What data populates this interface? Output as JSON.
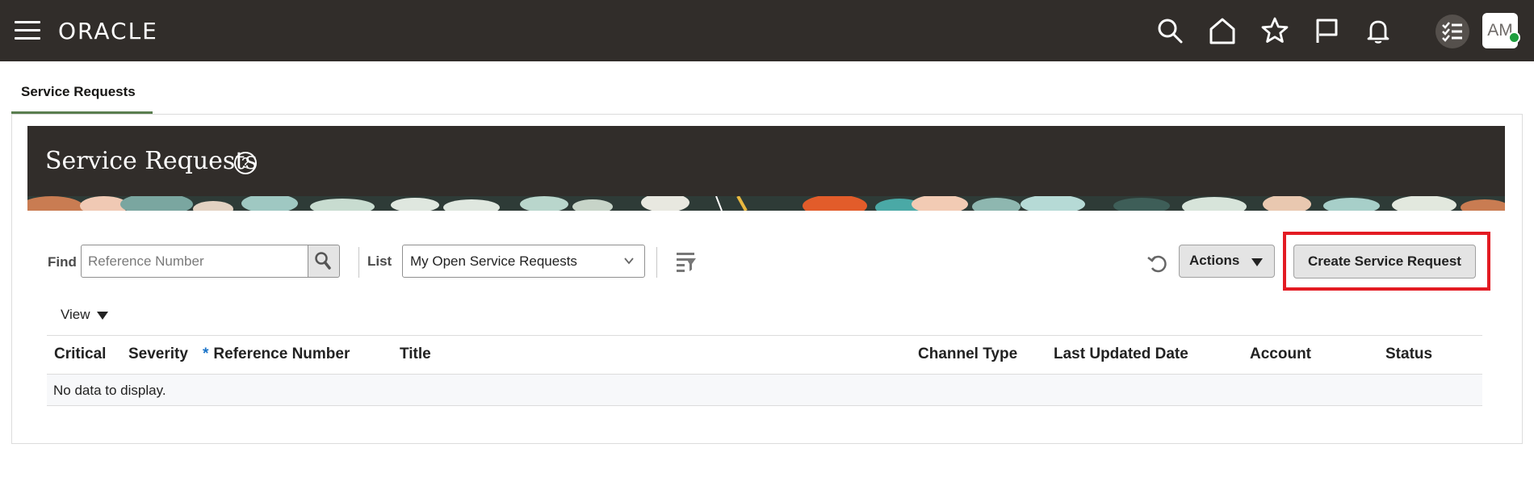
{
  "app": {
    "logo": "ORACLE",
    "avatar_initials": "AM",
    "status_color": "#1e9e3e"
  },
  "topbar_icons": [
    "search-icon",
    "home-icon",
    "favorites-star-icon",
    "flag-icon",
    "notifications-bell-icon",
    "tasks-icon"
  ],
  "tabs": [
    {
      "label": "Service Requests",
      "active": true
    }
  ],
  "page": {
    "title": "Service Requests",
    "help_glyph": "?"
  },
  "toolbar": {
    "find_label": "Find",
    "find_placeholder": "Reference Number",
    "list_label": "List",
    "list_selected": "My Open Service Requests",
    "actions_label": "Actions",
    "create_label": "Create Service Request",
    "view_label": "View"
  },
  "table": {
    "columns": [
      "Critical",
      "Severity",
      "Reference Number",
      "Title",
      "Channel Type",
      "Last Updated Date",
      "Account",
      "Status"
    ],
    "required_marker": "*",
    "empty_message": "No data to display."
  },
  "colors": {
    "header_bg": "#312d2a",
    "tab_underline": "#5a7e4f",
    "highlight_box": "#e31b23"
  }
}
